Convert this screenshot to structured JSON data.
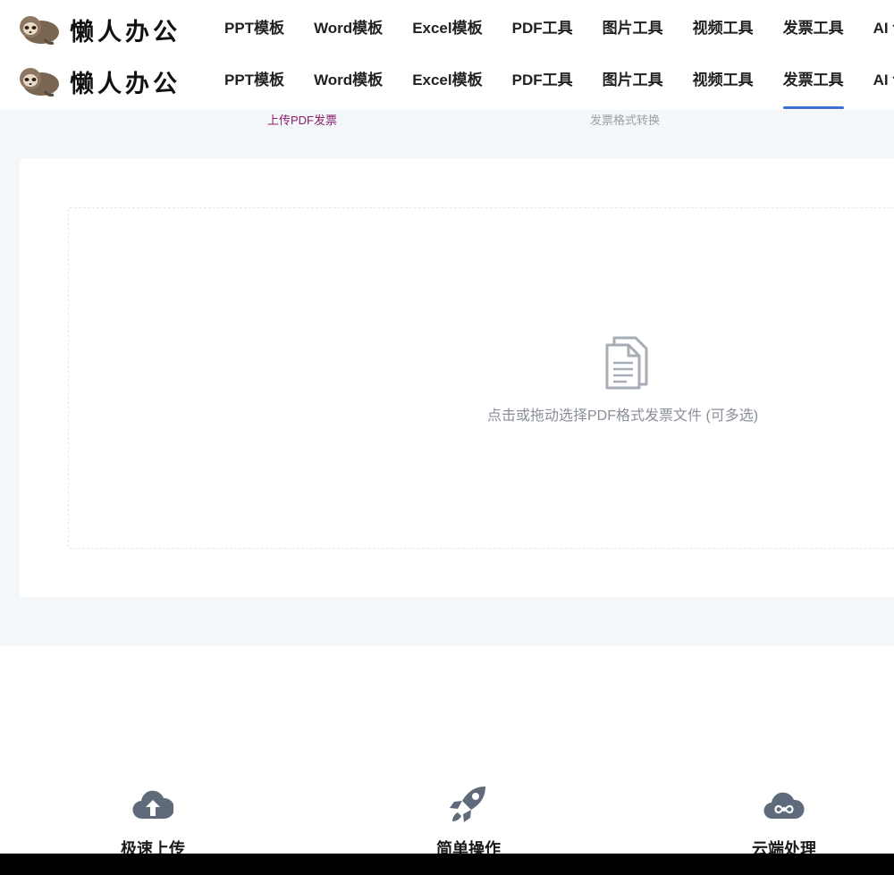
{
  "brand": {
    "name": "懒人办公",
    "logo_icon": "sloth-icon"
  },
  "nav": {
    "items": [
      {
        "label": "PPT模板"
      },
      {
        "label": "Word模板"
      },
      {
        "label": "Excel模板"
      },
      {
        "label": "PDF工具"
      },
      {
        "label": "图片工具"
      },
      {
        "label": "视频工具"
      },
      {
        "label": "发票工具"
      },
      {
        "label": "AI 创作"
      }
    ],
    "active": "发票工具",
    "active_color": "#3a6fd8"
  },
  "subtabs": {
    "items": [
      {
        "label": "上传PDF发票"
      },
      {
        "label": "发票格式转换"
      }
    ],
    "active_color": "#8b1e6b"
  },
  "upload": {
    "icon": "document-icon",
    "hint": "点击或拖动选择PDF格式发票文件 (可多选)"
  },
  "features": [
    {
      "icon": "cloud-upload-icon",
      "title": "极速上传"
    },
    {
      "icon": "rocket-icon",
      "title": "简单操作"
    },
    {
      "icon": "cloud-infinity-icon",
      "title": "云端处理"
    }
  ],
  "colors": {
    "feature_icon": "#5f6b7a",
    "page_bg": "#f4f7fa"
  }
}
